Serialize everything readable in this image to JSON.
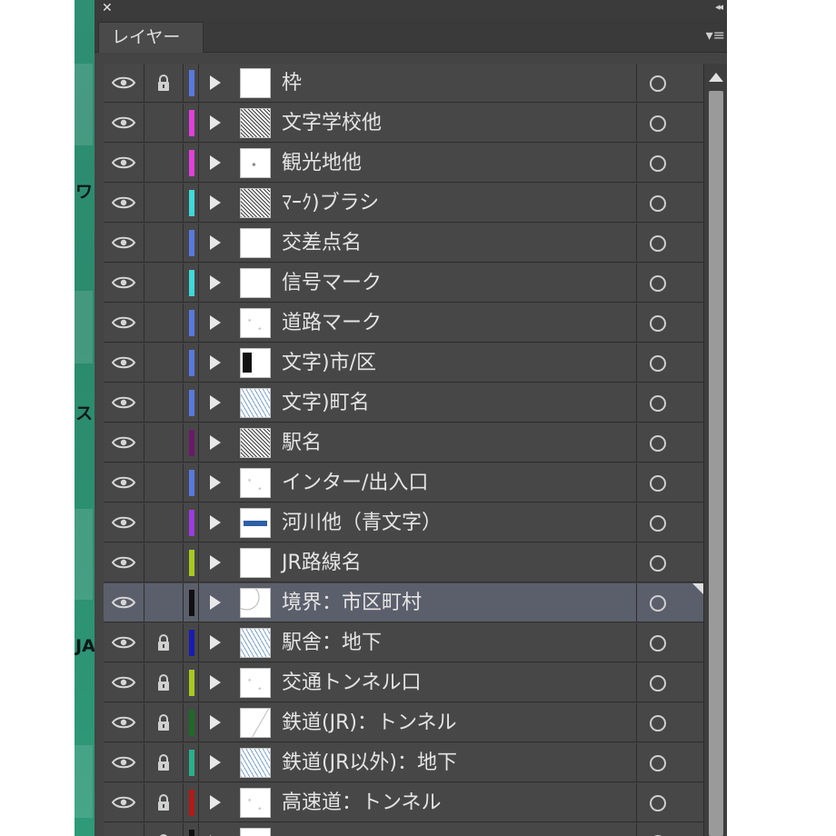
{
  "panel": {
    "tab_label": "レイヤー",
    "close_glyph": "✕",
    "menu_glyph": "▾≡",
    "collapse_glyph": "◂◂"
  },
  "left_strip_fragments": [
    "ワ",
    "ス",
    "JA"
  ],
  "layers": [
    {
      "name": "枠",
      "visible": true,
      "locked": true,
      "color": "#5a78e0",
      "thumb": "t-blank",
      "selected": false
    },
    {
      "name": "文字学校他",
      "visible": true,
      "locked": false,
      "color": "#e040d8",
      "thumb": "t-dense",
      "selected": false
    },
    {
      "name": "観光地他",
      "visible": true,
      "locked": false,
      "color": "#e040d8",
      "thumb": "t-dot",
      "selected": false
    },
    {
      "name": "ﾏｰｸ)ブラシ",
      "visible": true,
      "locked": false,
      "color": "#40d8d8",
      "thumb": "t-dense",
      "selected": false
    },
    {
      "name": "交差点名",
      "visible": true,
      "locked": false,
      "color": "#5a78e0",
      "thumb": "t-blank",
      "selected": false
    },
    {
      "name": "信号マーク",
      "visible": true,
      "locked": false,
      "color": "#40d8d8",
      "thumb": "t-blank",
      "selected": false
    },
    {
      "name": "道路マーク",
      "visible": true,
      "locked": false,
      "color": "#5a78e0",
      "thumb": "t-sparse",
      "selected": false
    },
    {
      "name": "文字)市/区",
      "visible": true,
      "locked": false,
      "color": "#5a78e0",
      "thumb": "t-black",
      "selected": false
    },
    {
      "name": "文字)町名",
      "visible": true,
      "locked": false,
      "color": "#5a78e0",
      "thumb": "t-blue",
      "selected": false
    },
    {
      "name": "駅名",
      "visible": true,
      "locked": false,
      "color": "#6a1a6a",
      "thumb": "t-dense",
      "selected": false
    },
    {
      "name": "インター/出入口",
      "visible": true,
      "locked": false,
      "color": "#5a78e0",
      "thumb": "t-sparse",
      "selected": false
    },
    {
      "name": "河川他（青文字）",
      "visible": true,
      "locked": false,
      "color": "#9a3ce0",
      "thumb": "t-band",
      "selected": false
    },
    {
      "name": "JR路線名",
      "visible": true,
      "locked": false,
      "color": "#a8c820",
      "thumb": "t-blank",
      "selected": false
    },
    {
      "name": "境界：市区町村",
      "visible": true,
      "locked": false,
      "color": "#101010",
      "thumb": "t-curve",
      "selected": true
    },
    {
      "name": "駅舎：地下",
      "visible": true,
      "locked": true,
      "color": "#1a1ab0",
      "thumb": "t-blue",
      "selected": false
    },
    {
      "name": "交通トンネル口",
      "visible": true,
      "locked": true,
      "color": "#a8c820",
      "thumb": "t-sparse",
      "selected": false
    },
    {
      "name": "鉄道(JR)：トンネル",
      "visible": true,
      "locked": true,
      "color": "#1f6a2a",
      "thumb": "t-line",
      "selected": false
    },
    {
      "name": "鉄道(JR以外)：地下",
      "visible": true,
      "locked": true,
      "color": "#2ab08a",
      "thumb": "t-blue",
      "selected": false
    },
    {
      "name": "高速道：トンネル",
      "visible": true,
      "locked": true,
      "color": "#b01a1a",
      "thumb": "t-sparse",
      "selected": false
    },
    {
      "name": "",
      "visible": true,
      "locked": true,
      "color": "#101010",
      "thumb": "t-blank",
      "selected": false
    }
  ]
}
